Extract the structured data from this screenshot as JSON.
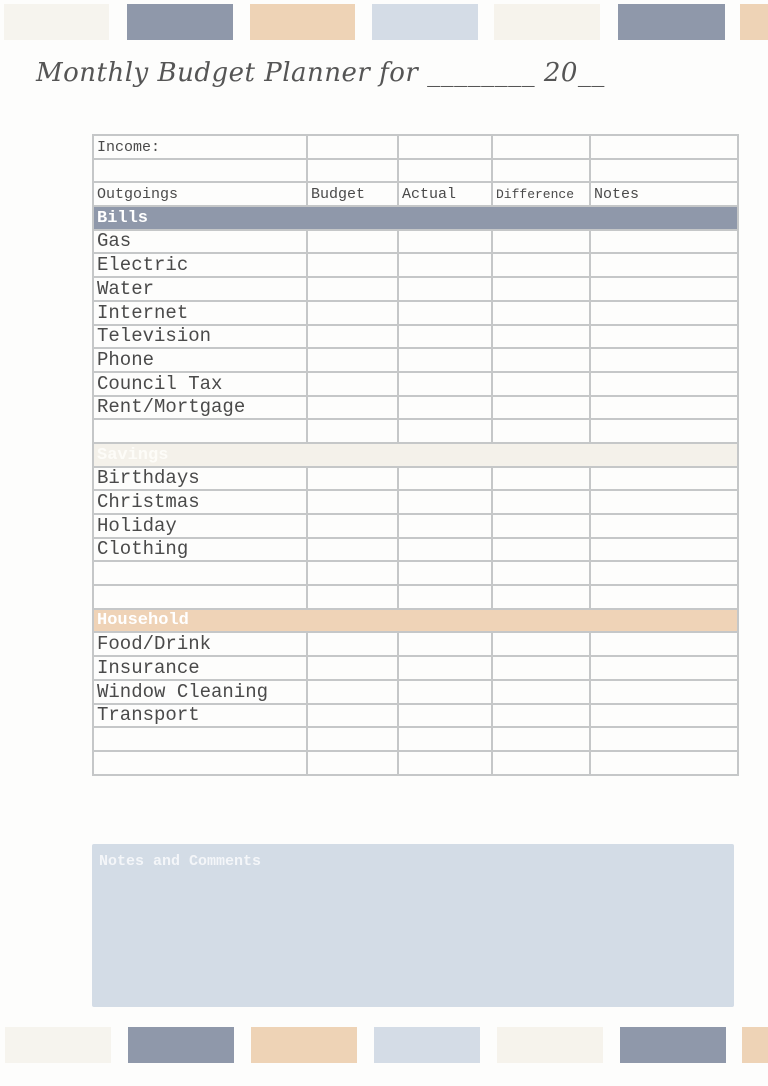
{
  "title": "Monthly Budget Planner for ________ 20__",
  "swatch_colors": [
    "#f6f4ee",
    "#8f98aa",
    "#eed3b6",
    "#d4dce6",
    "#f6f3ec",
    "#8f98aa",
    "#eed3b6"
  ],
  "table": {
    "income_label": "Income:",
    "columns": [
      "Outgoings",
      "Budget",
      "Actual",
      "Difference",
      "Notes"
    ],
    "sections": [
      {
        "name": "Bills",
        "color": "#8f98aa",
        "items": [
          "Gas",
          "Electric",
          "Water",
          "Internet",
          "Television",
          "Phone",
          "Council Tax",
          "Rent/Mortgage",
          ""
        ]
      },
      {
        "name": "Savings",
        "color": "#f4f1ea",
        "items": [
          "Birthdays",
          "Christmas",
          "Holiday",
          "Clothing",
          "",
          ""
        ]
      },
      {
        "name": "Household",
        "color": "#efd3b7",
        "items": [
          "Food/Drink",
          "Insurance",
          "Window Cleaning",
          "Transport",
          "",
          ""
        ]
      }
    ]
  },
  "notes": {
    "label": "Notes and Comments",
    "color": "#d3dce6"
  }
}
